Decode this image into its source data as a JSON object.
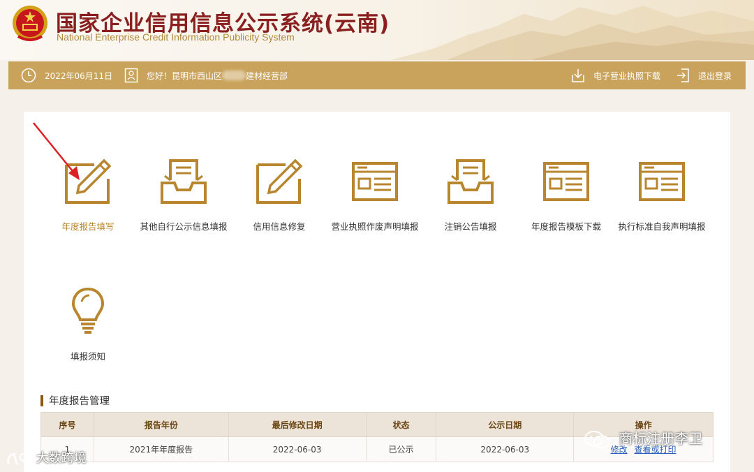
{
  "header": {
    "title_cn": "国家企业信用信息公示系统(云南)",
    "title_en": "National Enterprise Credit Information Publicity System"
  },
  "toolbar": {
    "date": "2022年06月11日",
    "greeting_prefix": "您好！昆明市西山区",
    "greeting_suffix": "建材经营部",
    "download_license": "电子营业执照下载",
    "logout": "退出登录"
  },
  "tiles": [
    {
      "label": "年度报告填写",
      "icon": "edit-pencil-icon"
    },
    {
      "label": "其他自行公示信息填报",
      "icon": "inbox-tray-icon"
    },
    {
      "label": "信用信息修复",
      "icon": "edit-pencil-icon"
    },
    {
      "label": "营业执照作废声明填报",
      "icon": "document-window-icon"
    },
    {
      "label": "注销公告填报",
      "icon": "inbox-tray-icon"
    },
    {
      "label": "年度报告模板下载",
      "icon": "document-window-icon"
    },
    {
      "label": "执行标准自我声明填报",
      "icon": "document-window-icon"
    },
    {
      "label": "填报须知",
      "icon": "lightbulb-icon"
    }
  ],
  "section": {
    "title": "年度报告管理"
  },
  "table": {
    "headers": [
      "序号",
      "报告年份",
      "最后修改日期",
      "状态",
      "公示日期",
      "操作"
    ],
    "rows": [
      {
        "index": "1",
        "year": "2021年年度报告",
        "modified": "2022-06-03",
        "status": "已公示",
        "published": "2022-06-03",
        "action_edit": "修改",
        "action_view": "查看或打印"
      }
    ]
  },
  "watermarks": {
    "wechat": "商标注册李卫",
    "bottom_left": "大数跨境"
  },
  "colors": {
    "gold": "#c9a35b",
    "title_red": "#8a1f1f",
    "icon_gold": "#b8862e"
  }
}
